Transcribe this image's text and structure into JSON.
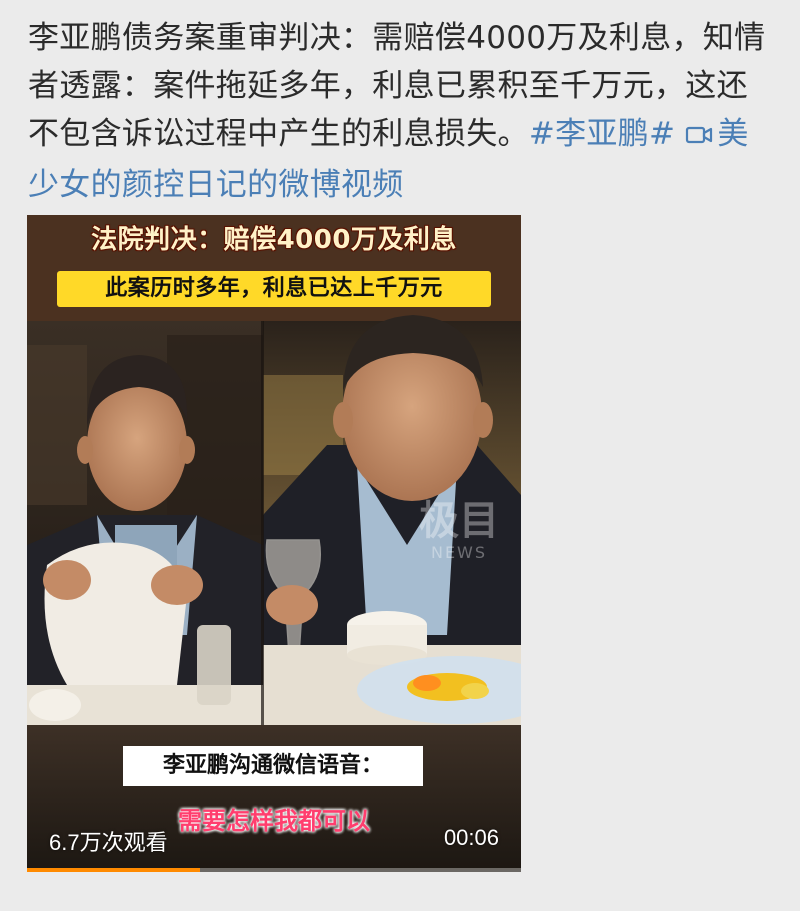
{
  "post": {
    "text": "李亚鹏债务案重审判决：需赔偿4000万及利息，知情者透露：案件拖延多年，利息已累积至千万元，这还不包含诉讼过程中产生的利息损失。",
    "hashtag": "#李亚鹏#",
    "video_link_icon": "video-camera-icon",
    "video_link_label": "美少女的颜控日记的微博视频"
  },
  "video": {
    "caption_top": "法院判决：赔偿4000万及利息",
    "caption_yellow": "此案历时多年，利息已达上千万元",
    "caption_white": "李亚鹏沟通微信语音：",
    "caption_quote": "需要怎样我都可以",
    "watermark_main": "极目",
    "watermark_sub": "NEWS",
    "view_count": "6.7万次观看",
    "duration": "00:06",
    "progress": 0.35
  },
  "colors": {
    "link": "#4b7fb6",
    "text": "#2b2b2b",
    "background": "#ebebeb",
    "caption_yellow_bg": "#ffd928",
    "progress": "#ff8a00",
    "quote_text": "#ff3e6e"
  }
}
